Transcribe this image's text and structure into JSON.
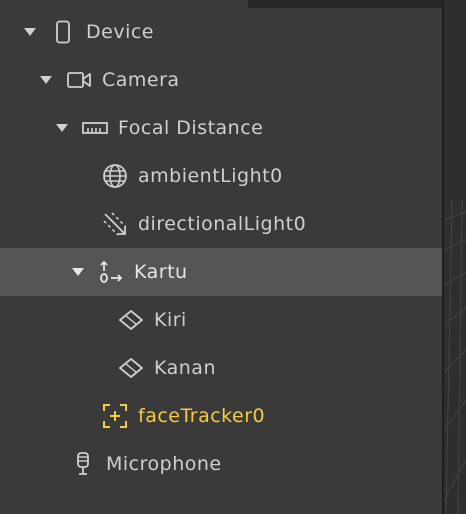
{
  "scene_tree": {
    "items": [
      {
        "label": "Device",
        "icon": "phone-icon",
        "expanded": true
      },
      {
        "label": "Camera",
        "icon": "camera-icon",
        "expanded": true
      },
      {
        "label": "Focal Distance",
        "icon": "ruler-icon",
        "expanded": true
      },
      {
        "label": "ambientLight0",
        "icon": "globe-icon"
      },
      {
        "label": "directionalLight0",
        "icon": "directional-light-icon"
      },
      {
        "label": "Kartu",
        "icon": "null-object-icon",
        "expanded": true,
        "selected": true
      },
      {
        "label": "Kiri",
        "icon": "plane-icon"
      },
      {
        "label": "Kanan",
        "icon": "plane-icon"
      },
      {
        "label": "faceTracker0",
        "icon": "face-tracker-icon",
        "highlight_color": "#f5cc3a"
      },
      {
        "label": "Microphone",
        "icon": "microphone-icon"
      }
    ]
  },
  "colors": {
    "background": "#3a3a3a",
    "selected_row": "#555555",
    "text": "#cfcfcf",
    "accent": "#f5cc3a"
  }
}
